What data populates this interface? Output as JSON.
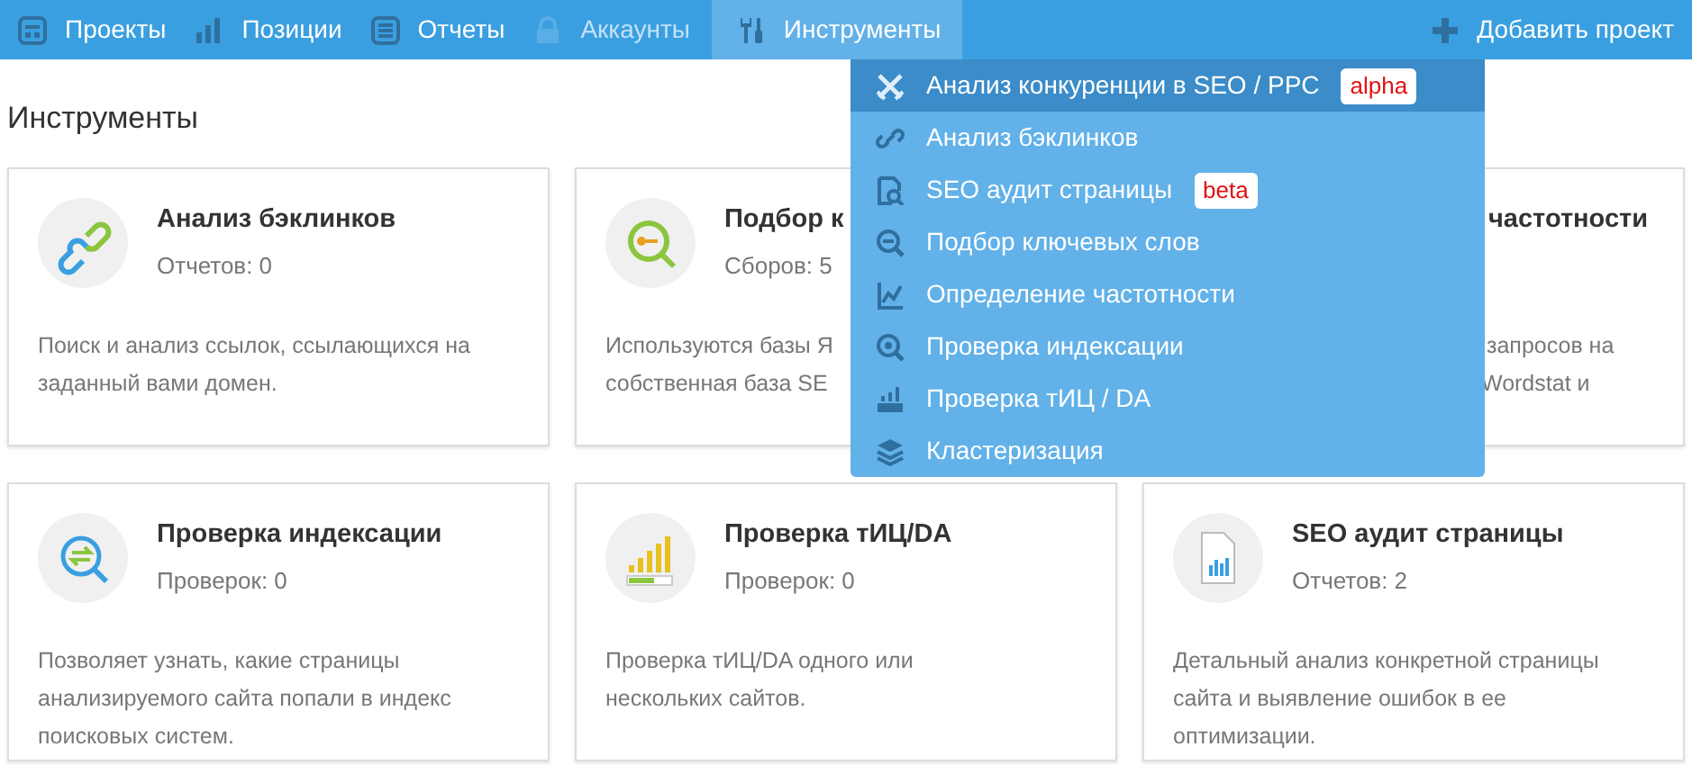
{
  "navbar": {
    "items": [
      {
        "label": "Проекты",
        "selected": false,
        "disabled": false
      },
      {
        "label": "Позиции",
        "selected": false,
        "disabled": false
      },
      {
        "label": "Отчеты",
        "selected": false,
        "disabled": false
      },
      {
        "label": "Аккаунты",
        "selected": false,
        "disabled": true
      },
      {
        "label": "Инструменты",
        "selected": true,
        "disabled": false
      }
    ],
    "add_button": "Добавить проект"
  },
  "heading": "Инструменты",
  "cards": [
    {
      "title": "Анализ бэклинков",
      "count": "Отчетов: 0",
      "description": [
        "Поиск и анализ ссылок, ссылающихся на",
        "заданный вами домен."
      ]
    },
    {
      "title": "Подбор к",
      "count": "Сборов: 5",
      "description": [
        "Используются базы Я",
        "собственная база SE"
      ]
    },
    {
      "title": "частотности",
      "description": [
        "запросов на",
        "Wordstat и"
      ]
    },
    {
      "title": "Проверка индексации",
      "count": "Проверок: 0",
      "description": [
        "Позволяет узнать, какие страницы",
        "анализируемого сайта попали в индекс",
        "поисковых систем."
      ]
    },
    {
      "title": "Проверка тИЦ/DA",
      "count": "Проверок: 0",
      "description": [
        "Проверка тИЦ/DA одного или",
        "нескольких сайтов."
      ]
    },
    {
      "title": "SEO аудит страницы",
      "count": "Отчетов: 2",
      "description": [
        "Детальный анализ конкретной страницы",
        "сайта и выявление ошибок в ее",
        "оптимизации."
      ]
    }
  ],
  "dropdown": [
    {
      "label": "Анализ конкуренции в SEO / PPC",
      "badge": "alpha",
      "selected": true
    },
    {
      "label": "Анализ бэклинков",
      "selected": false
    },
    {
      "label": "SEO аудит страницы",
      "badge": "beta",
      "selected": false
    },
    {
      "label": "Подбор ключевых слов",
      "selected": false
    },
    {
      "label": "Определение частотности",
      "selected": false
    },
    {
      "label": "Проверка индексации",
      "selected": false
    },
    {
      "label": "Проверка тИЦ / DA",
      "selected": false
    },
    {
      "label": "Кластеризация",
      "selected": false
    }
  ]
}
